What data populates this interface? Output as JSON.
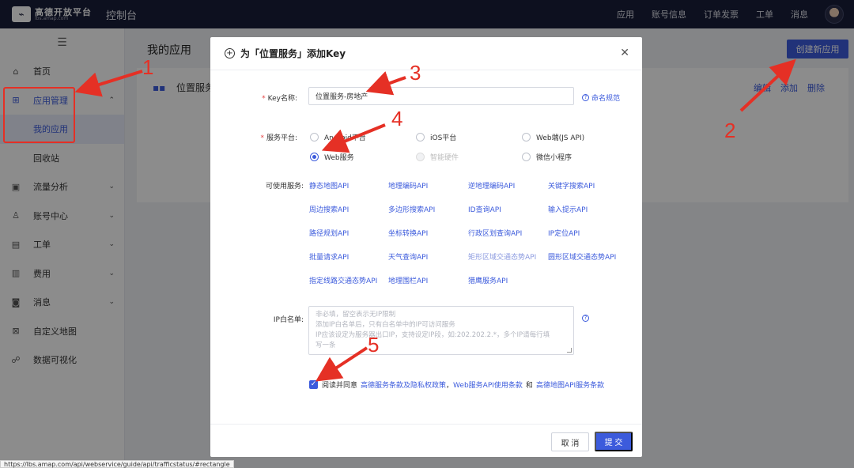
{
  "topbar": {
    "logo_text": "高德开放平台",
    "logo_sub": "lbs.amap.com",
    "console": "控制台",
    "nav": [
      "应用",
      "账号信息",
      "订单发票",
      "工单",
      "消息"
    ]
  },
  "sidebar": {
    "items": [
      {
        "label": "首页",
        "icon": "home-icon"
      },
      {
        "label": "应用管理",
        "icon": "grid-icon"
      },
      {
        "label": "我的应用",
        "icon": ""
      },
      {
        "label": "回收站",
        "icon": ""
      },
      {
        "label": "流量分析",
        "icon": "chart-icon"
      },
      {
        "label": "账号中心",
        "icon": "user-icon"
      },
      {
        "label": "工单",
        "icon": "ticket-icon"
      },
      {
        "label": "费用",
        "icon": "money-icon"
      },
      {
        "label": "消息",
        "icon": "message-icon"
      },
      {
        "label": "自定义地图",
        "icon": "map-icon"
      },
      {
        "label": "数据可视化",
        "icon": "visual-icon"
      }
    ]
  },
  "main": {
    "title": "我的应用",
    "create_button": "创建新应用",
    "card_title": "位置服务",
    "card_actions": [
      "编辑",
      "添加",
      "删除"
    ]
  },
  "modal": {
    "title": "为「位置服务」添加Key",
    "key_name_label": "Key名称:",
    "key_name_value": "位置服务-房地产",
    "naming_hint": "命名规范",
    "platform_label": "服务平台:",
    "platforms": [
      {
        "label": "Android平台",
        "checked": false,
        "disabled": false
      },
      {
        "label": "iOS平台",
        "checked": false,
        "disabled": false
      },
      {
        "label": "Web端(JS API)",
        "checked": false,
        "disabled": false
      },
      {
        "label": "Web服务",
        "checked": true,
        "disabled": false
      },
      {
        "label": "智能硬件",
        "checked": false,
        "disabled": true
      },
      {
        "label": "微信小程序",
        "checked": false,
        "disabled": false
      }
    ],
    "services_label": "可使用服务:",
    "services": [
      [
        "静态地图API",
        "地理编码API",
        "逆地理编码API",
        "关键字搜索API"
      ],
      [
        "周边搜索API",
        "多边形搜索API",
        "ID查询API",
        "输入提示API"
      ],
      [
        "路径规划API",
        "坐标转换API",
        "行政区划查询API",
        "IP定位API"
      ],
      [
        "批量请求API",
        "天气查询API",
        "矩形区域交通态势API",
        "圆形区域交通态势API"
      ],
      [
        "指定线路交通态势API",
        "地理围栏API",
        "猎鹰服务API",
        ""
      ]
    ],
    "ip_label": "IP白名单:",
    "ip_placeholder": [
      "非必填，留空表示无IP限制",
      "添加IP白名单后，只有白名单中的IP可访问服务",
      "IP应该设定为服务器出口IP，支持设定IP段，如:202.202.2.*，多个IP请每行填",
      "写一条"
    ],
    "agree_prefix": "阅读并同意",
    "agree_link1": "高德服务条款及隐私权政策",
    "agree_sep": "，",
    "agree_link2": "Web服务API使用条款",
    "agree_and": "和",
    "agree_link3": "高德地图API服务条款",
    "cancel": "取 消",
    "submit": "提 交"
  },
  "status_url": "https://lbs.amap.com/api/webservice/guide/api/trafficstatus/#rectangle",
  "annotations": [
    "1",
    "2",
    "3",
    "4",
    "5"
  ],
  "colors": {
    "accent": "#3c5bdc",
    "topbar": "#191e3a",
    "annotation": "#e53025"
  }
}
